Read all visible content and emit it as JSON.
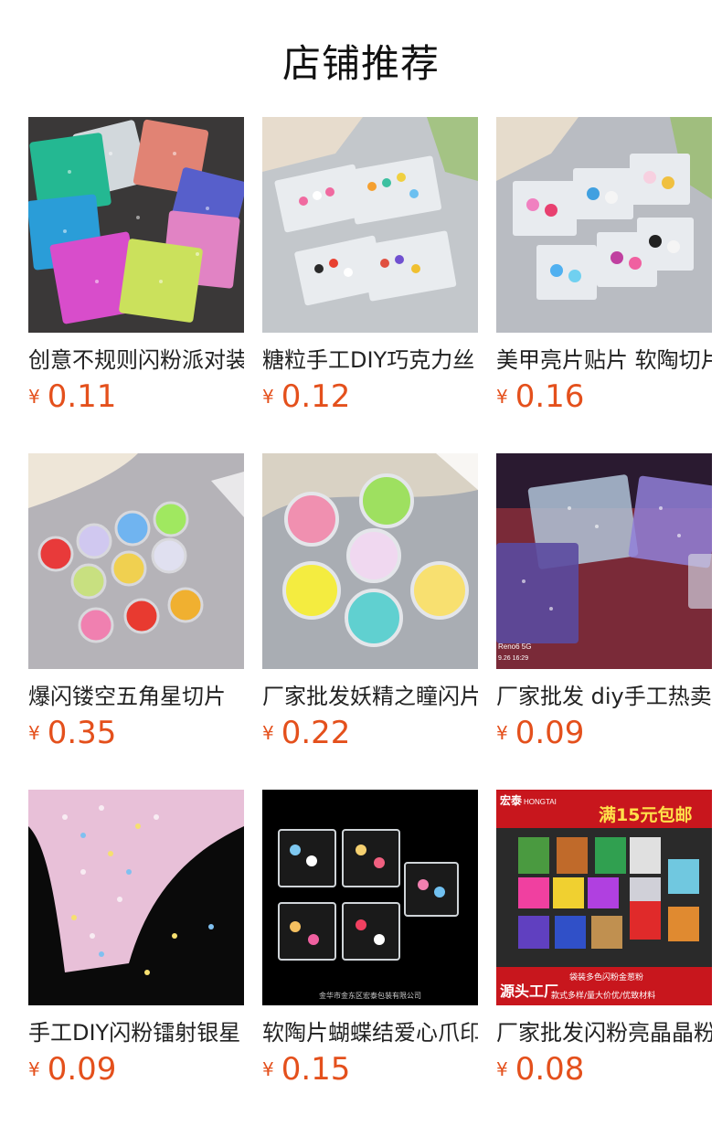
{
  "section": {
    "title": "店铺推荐"
  },
  "theme": {
    "price_color": "#e4501c"
  },
  "products": [
    {
      "name": "创意不规则闪粉派对装饰",
      "currency": "¥",
      "price": "0.11",
      "image": "glitter-packets-assorted-colors"
    },
    {
      "name": "糖粒手工DIY巧克力丝",
      "currency": "¥",
      "price": "0.12",
      "image": "candy-sprinkle-packets"
    },
    {
      "name": "美甲亮片贴片 软陶切片",
      "currency": "¥",
      "price": "0.16",
      "image": "nail-polymer-clay-slices"
    },
    {
      "name": "爆闪镂空五角星切片",
      "currency": "¥",
      "price": "0.35",
      "image": "star-sequins-in-jars"
    },
    {
      "name": "厂家批发妖精之瞳闪片",
      "currency": "¥",
      "price": "0.22",
      "image": "iridescent-sequins-in-jars"
    },
    {
      "name": "厂家批发 diy手工热卖",
      "currency": "¥",
      "price": "0.09",
      "image": "purple-glitter-packets"
    },
    {
      "name": "手工DIY闪粉镭射银星",
      "currency": "¥",
      "price": "0.09",
      "image": "pastel-star-confetti-pile"
    },
    {
      "name": "软陶片蝴蝶结爱心爪印",
      "currency": "¥",
      "price": "0.15",
      "image": "polymer-clay-packets-black-bg"
    },
    {
      "name": "厂家批发闪粉亮晶晶粉",
      "currency": "¥",
      "price": "0.08",
      "image": "hongtai-glitter-packets-ad"
    }
  ],
  "image_captions": {
    "renoo": "Reno6 5G",
    "renoo_date": "9.26 16:29",
    "company": "金华市金东区宏泰包装有限公司",
    "brand": "宏泰",
    "brand_en": "HONGTAI",
    "promo": "满15元包邮",
    "banner_main": "源头工厂",
    "banner_top": "袋装多色闪粉金葱粉",
    "banner_bottom": "款式多样/量大价优/优致材料"
  }
}
